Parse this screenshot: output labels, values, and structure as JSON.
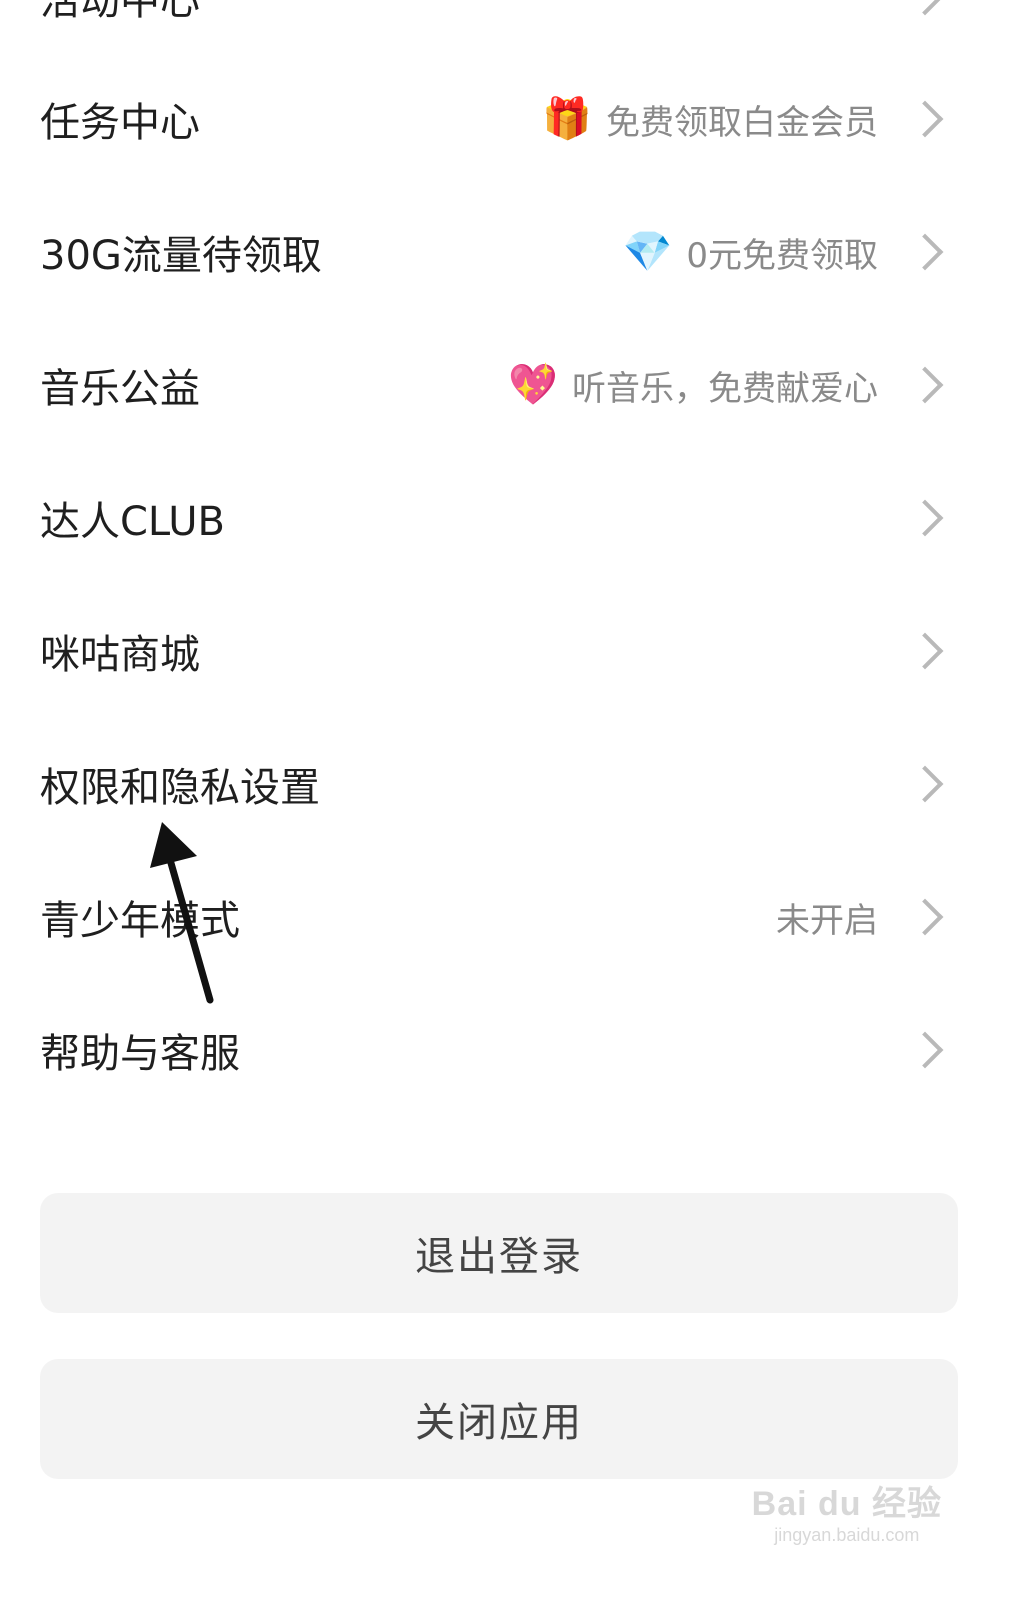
{
  "menu": {
    "items": [
      {
        "label": "活动中心",
        "right_text": "",
        "emoji": ""
      },
      {
        "label": "任务中心",
        "right_text": "免费领取白金会员",
        "emoji": "🎁",
        "emoji_name": "gift-icon"
      },
      {
        "label": "30G流量待领取",
        "right_text": "0元免费领取",
        "emoji": "💎",
        "emoji_name": "diamond-icon"
      },
      {
        "label": "音乐公益",
        "right_text": "听音乐，免费献爱心",
        "emoji": "💖",
        "emoji_name": "sparkling-heart-icon"
      },
      {
        "label": "达人CLUB",
        "right_text": "",
        "emoji": ""
      },
      {
        "label": "咪咕商城",
        "right_text": "",
        "emoji": ""
      },
      {
        "label": "权限和隐私设置",
        "right_text": "",
        "emoji": ""
      },
      {
        "label": "青少年模式",
        "right_text": "未开启",
        "emoji": ""
      },
      {
        "label": "帮助与客服",
        "right_text": "",
        "emoji": ""
      }
    ]
  },
  "buttons": {
    "logout": "退出登录",
    "close_app": "关闭应用"
  },
  "watermark": {
    "main": "Bai du 经验",
    "sub": "jingyan.baidu.com"
  },
  "colors": {
    "background": "#ffffff",
    "button_bg": "#f3f3f3",
    "secondary_text": "#8a8a8a",
    "annotation_arrow": "#111111"
  }
}
